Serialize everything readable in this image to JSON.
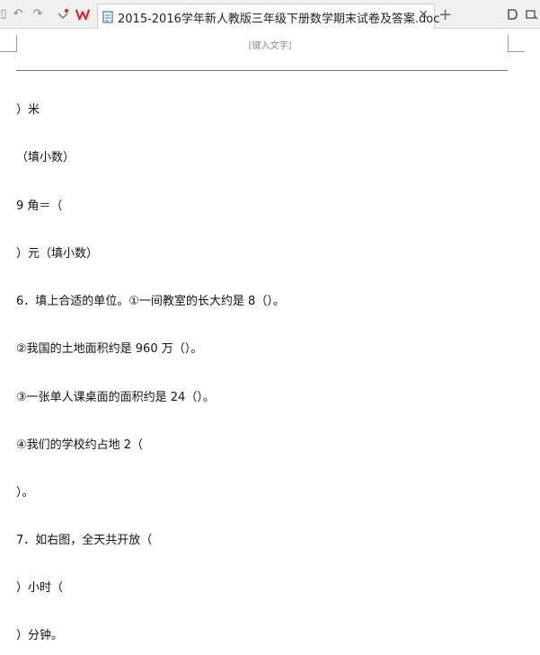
{
  "tab": {
    "title": "2015-2016学年新人教版三年级下册数学期末试卷及答案.doc",
    "close": "×"
  },
  "toolbar": {
    "add": "+"
  },
  "document": {
    "header_placeholder": "[键入文字]",
    "lines": [
      "）米",
      "（填小数）",
      "9 角＝（",
      "）元（填小数）",
      "6．填上合适的单位。①一间教室的长大约是 8（）。",
      "②我国的土地面积约是 960 万（）。",
      "③一张单人课桌面的面积约是 24（）。",
      "④我们的学校约占地 2（",
      "）。",
      "7．如右图，全天共开放（",
      "）小时（",
      "）分钟。"
    ]
  },
  "colors": {
    "wps_red": "#d9232d",
    "tab_bg": "#ffffff",
    "bar_bg": "#f0f0f0"
  }
}
